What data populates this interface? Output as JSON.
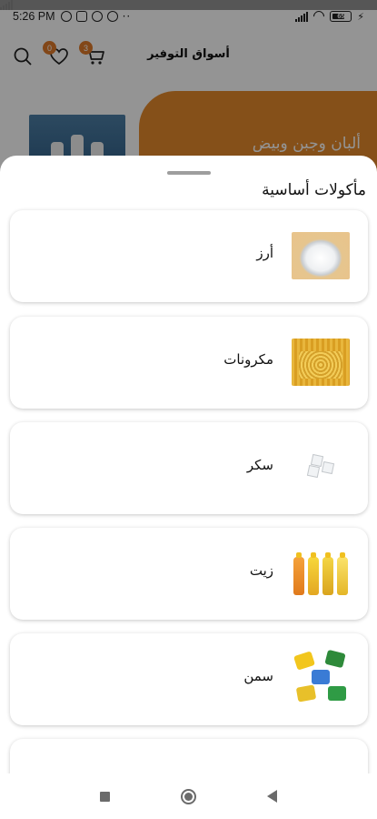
{
  "status_bar": {
    "time": "5:26 PM",
    "battery": "65"
  },
  "header": {
    "title": "أسواق التوفير",
    "favorites_badge": "0",
    "cart_badge": "3"
  },
  "banner": {
    "text": "ألبان وجبن وبيض"
  },
  "sheet": {
    "title": "مأكولات أساسية",
    "items": [
      {
        "label": "أرز",
        "icon": "rice-image"
      },
      {
        "label": "مكرونات",
        "icon": "pasta-image"
      },
      {
        "label": "سكر",
        "icon": "sugar-cubes-image"
      },
      {
        "label": "زيت",
        "icon": "oil-bottles-image"
      },
      {
        "label": "سمن",
        "icon": "ghee-cans-image"
      }
    ]
  },
  "colors": {
    "accent": "#e58a2c",
    "overlay": "rgba(0,0,0,0.42)"
  }
}
